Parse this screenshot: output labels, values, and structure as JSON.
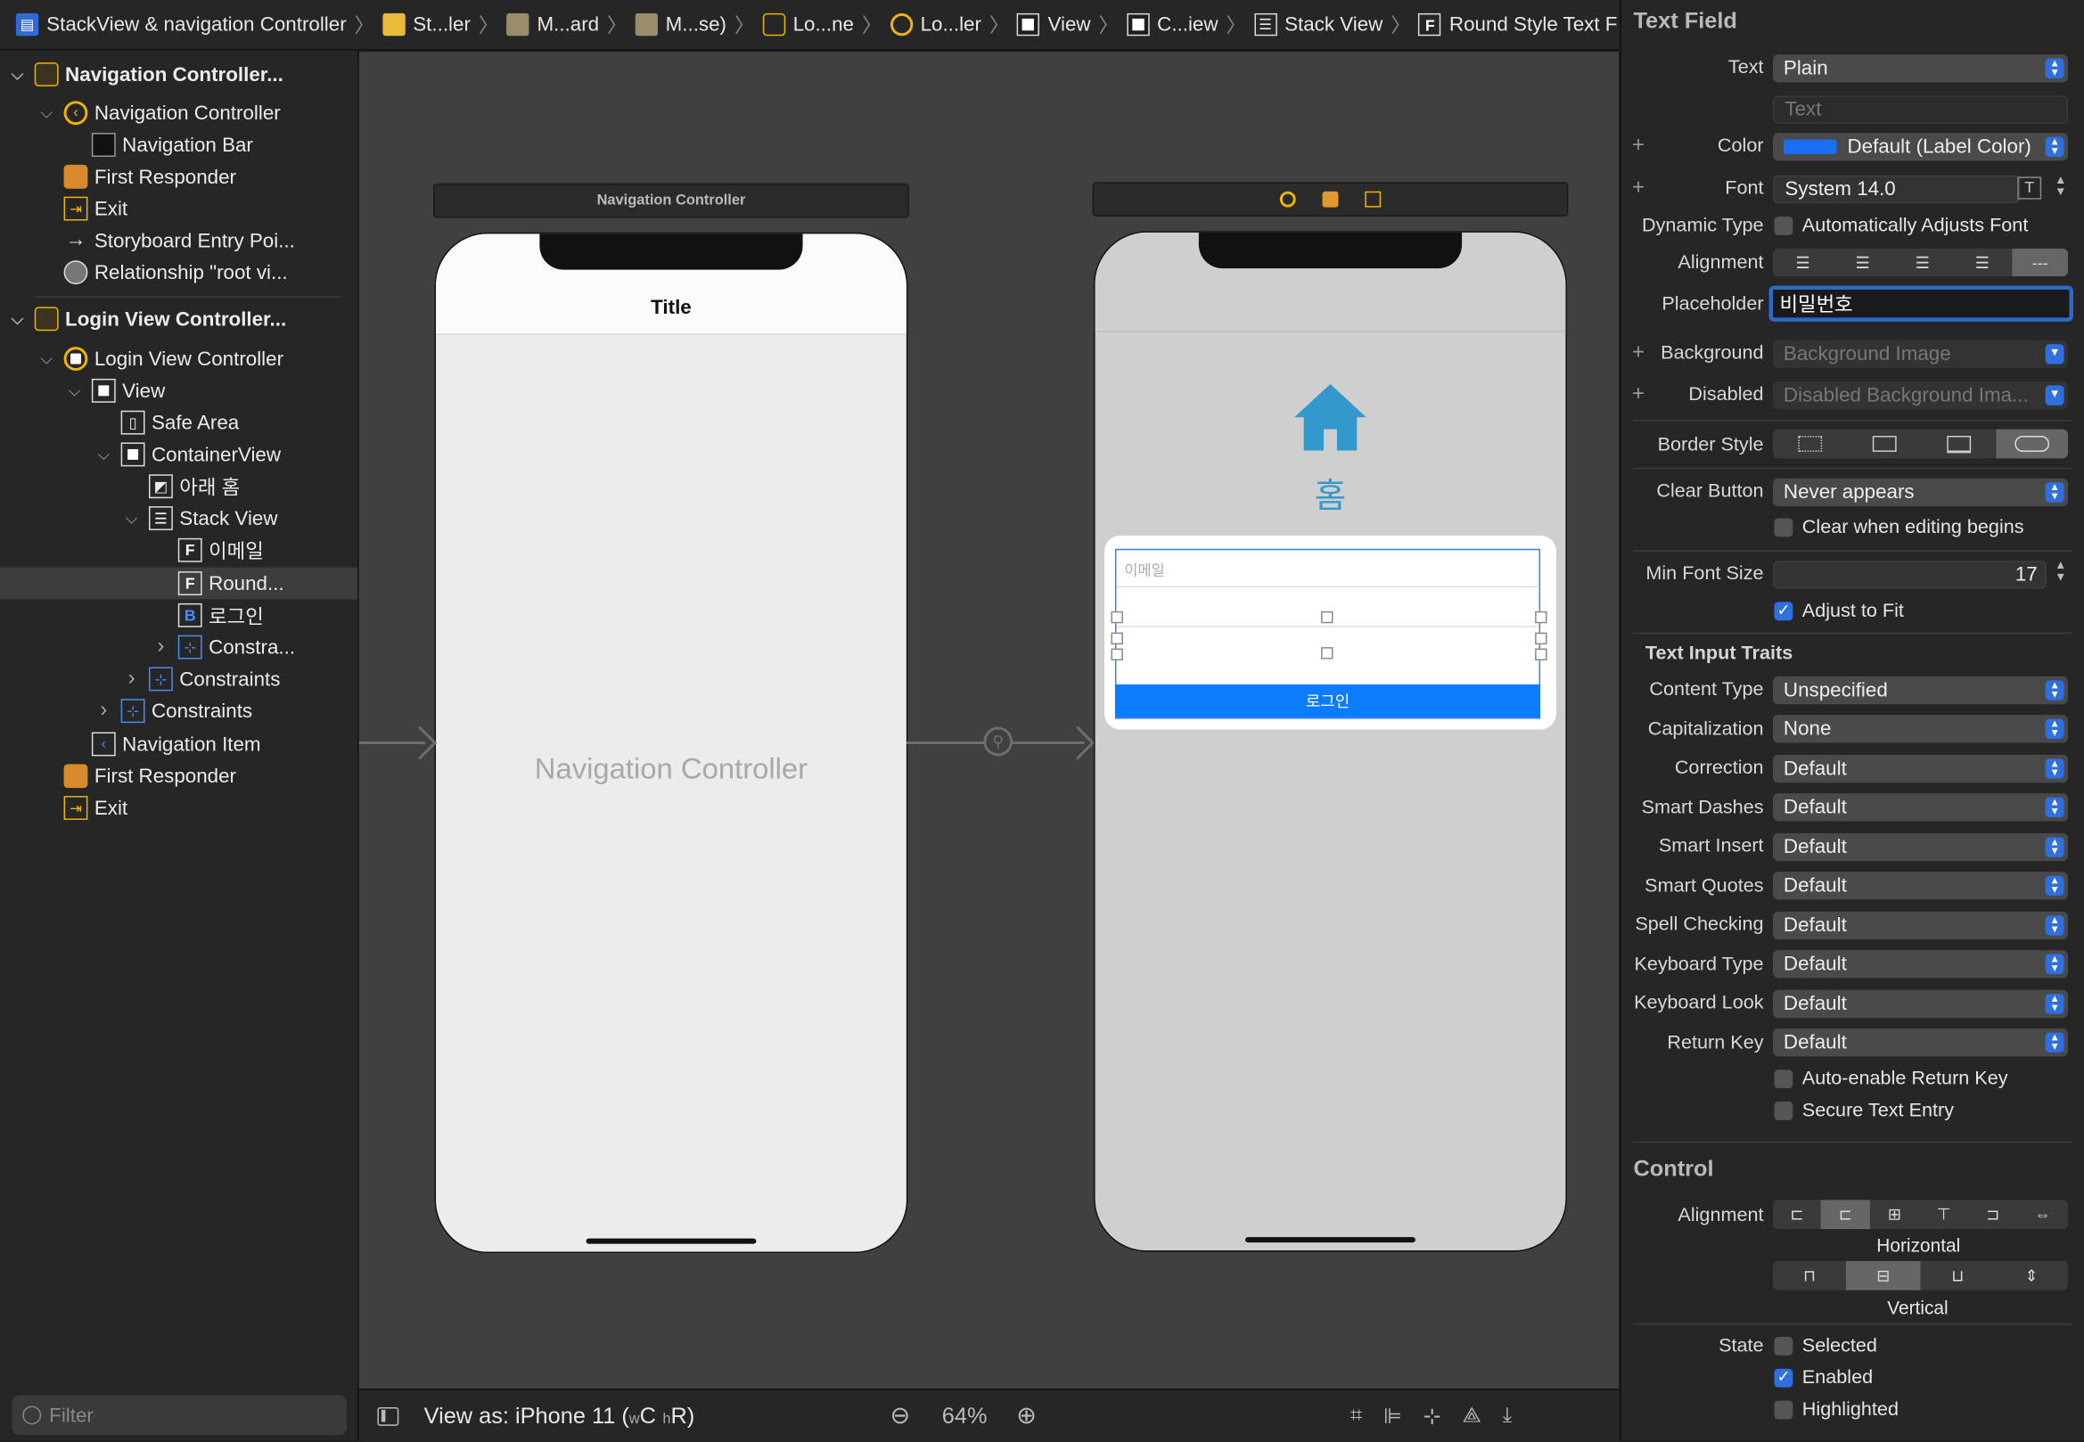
{
  "breadcrumb": [
    {
      "icon": "storyboard-file-icon",
      "label": "StackView & navigation Controller"
    },
    {
      "icon": "folder-icon",
      "label": "St...ler"
    },
    {
      "icon": "storyboard-icon",
      "label": "M...ard"
    },
    {
      "icon": "storyboard-icon",
      "label": "M...se)"
    },
    {
      "icon": "scene-icon",
      "label": "Lo...ne"
    },
    {
      "icon": "view-controller-icon",
      "label": "Lo...ler"
    },
    {
      "icon": "view-icon",
      "label": "View"
    },
    {
      "icon": "view-icon",
      "label": "C...iew"
    },
    {
      "icon": "stack-view-icon",
      "label": "Stack View"
    },
    {
      "icon": "text-field-icon",
      "label": "Round Style Text Field"
    }
  ],
  "outline": {
    "items": [
      {
        "label": "Navigation Controller...",
        "icon": "scene-icon",
        "bold": true,
        "disclosure": "open"
      },
      {
        "label": "Navigation Controller",
        "icon": "nav-controller-icon",
        "disclosure": "open"
      },
      {
        "label": "Navigation Bar",
        "icon": "navigation-bar-icon"
      },
      {
        "label": "First Responder",
        "icon": "first-responder-icon"
      },
      {
        "label": "Exit",
        "icon": "exit-icon"
      },
      {
        "label": "Storyboard Entry Poi...",
        "icon": "entry-arrow-icon"
      },
      {
        "label": "Relationship \"root vi...",
        "icon": "relationship-icon"
      },
      {
        "label": "Login View Controller...",
        "icon": "scene-icon",
        "bold": true,
        "disclosure": "open"
      },
      {
        "label": "Login View Controller",
        "icon": "view-controller-icon",
        "disclosure": "open"
      },
      {
        "label": "View",
        "icon": "view-icon",
        "disclosure": "open"
      },
      {
        "label": "Safe Area",
        "icon": "safe-area-icon"
      },
      {
        "label": "ContainerView",
        "icon": "view-icon",
        "disclosure": "open"
      },
      {
        "label": "아래 홈",
        "icon": "image-view-icon"
      },
      {
        "label": "Stack View",
        "icon": "stack-view-icon",
        "disclosure": "open"
      },
      {
        "label": "이메일",
        "icon": "text-field-icon"
      },
      {
        "label": "Round...",
        "icon": "text-field-icon",
        "selected": true
      },
      {
        "label": "로그인",
        "icon": "button-icon"
      },
      {
        "label": "Constra...",
        "icon": "constraints-icon",
        "disclosure": "closed"
      },
      {
        "label": "Constraints",
        "icon": "constraints-icon",
        "disclosure": "closed"
      },
      {
        "label": "Constraints",
        "icon": "constraints-icon",
        "disclosure": "closed"
      },
      {
        "label": "Navigation Item",
        "icon": "navigation-item-icon"
      },
      {
        "label": "First Responder",
        "icon": "first-responder-icon"
      },
      {
        "label": "Exit",
        "icon": "exit-icon"
      }
    ],
    "filter_placeholder": "Filter"
  },
  "canvas": {
    "nav_scene_title": "Navigation Controller",
    "nav_phone_title": "Title",
    "nav_placeholder": "Navigation Controller",
    "login_home_label": "홈",
    "email_placeholder": "이메일",
    "login_button": "로그인",
    "home_icon": "house-icon",
    "home_color": "#3399cc",
    "button_color": "#0a7cff"
  },
  "bottom_bar": {
    "view_as": "View as: iPhone 11 (",
    "size_w": "w",
    "size_c": "C",
    "size_h": "h",
    "size_r": "R)",
    "zoom": "64%"
  },
  "inspector": {
    "section_text_field": "Text Field",
    "text_label": "Text",
    "text_value": "Plain",
    "text_placeholder": "Text",
    "color_label": "Color",
    "color_value": "Default (Label Color)",
    "color_swatch": "#1a6ff5",
    "font_label": "Font",
    "font_value": "System 14.0",
    "dynamic_type_label": "Dynamic Type",
    "dynamic_type_check": "Automatically Adjusts Font",
    "alignment_label": "Alignment",
    "placeholder_label": "Placeholder",
    "placeholder_value": "비밀번호",
    "background_label": "Background",
    "background_value": "Background Image",
    "disabled_label": "Disabled",
    "disabled_value": "Disabled Background Ima...",
    "border_style_label": "Border Style",
    "clear_button_label": "Clear Button",
    "clear_button_value": "Never appears",
    "clear_editing_check": "Clear when editing begins",
    "min_font_label": "Min Font Size",
    "min_font_value": "17",
    "adjust_fit_check": "Adjust to Fit",
    "text_input_traits": "Text Input Traits",
    "traits": [
      {
        "label": "Content Type",
        "value": "Unspecified"
      },
      {
        "label": "Capitalization",
        "value": "None"
      },
      {
        "label": "Correction",
        "value": "Default"
      },
      {
        "label": "Smart Dashes",
        "value": "Default"
      },
      {
        "label": "Smart Insert",
        "value": "Default"
      },
      {
        "label": "Smart Quotes",
        "value": "Default"
      },
      {
        "label": "Spell Checking",
        "value": "Default"
      },
      {
        "label": "Keyboard Type",
        "value": "Default"
      },
      {
        "label": "Keyboard Look",
        "value": "Default"
      },
      {
        "label": "Return Key",
        "value": "Default"
      }
    ],
    "auto_return_check": "Auto-enable Return Key",
    "secure_entry_check": "Secure Text Entry",
    "section_control": "Control",
    "control_alignment_label": "Alignment",
    "horizontal_caption": "Horizontal",
    "vertical_caption": "Vertical",
    "state_label": "State",
    "state_selected": "Selected",
    "state_enabled": "Enabled",
    "state_highlighted": "Highlighted"
  }
}
